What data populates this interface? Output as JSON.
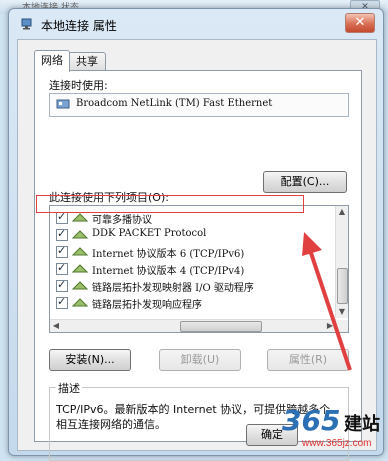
{
  "background_window": {
    "title": "本地连接 状态"
  },
  "dialog": {
    "title": "本地连接 属性",
    "close_label": "✕",
    "tabs": [
      {
        "label": "网络"
      },
      {
        "label": "共享"
      }
    ],
    "connect_using_label": "连接时使用:",
    "adapter_name": "Broadcom NetLink (TM) Fast Ethernet",
    "configure_button": "配置(C)...",
    "items_label": "此连接使用下列项目(O):",
    "items": [
      {
        "label": "可靠多播协议",
        "checked": true
      },
      {
        "label": "DDK PACKET Protocol",
        "checked": true
      },
      {
        "label": "Internet 协议版本 6 (TCP/IPv6)",
        "checked": true
      },
      {
        "label": "Internet 协议版本 4 (TCP/IPv4)",
        "checked": true,
        "highlighted": true
      },
      {
        "label": "链路层拓扑发现映射器 I/O 驱动程序",
        "checked": true
      },
      {
        "label": "链路层拓扑发现响应程序",
        "checked": true
      }
    ],
    "install_button": "安装(N)...",
    "uninstall_button": "卸载(U)",
    "properties_button": "属性(R)",
    "description_legend": "描述",
    "description_text": "TCP/IPv6。最新版本的 Internet 协议，可提供跨越多个相互连接网络的通信。",
    "ok_button": "确定"
  },
  "watermark": {
    "number": "365",
    "word": "建站",
    "url": "www.365jz.com"
  },
  "colors": {
    "highlight_border": "#e04040",
    "arrow": "#e04040"
  }
}
